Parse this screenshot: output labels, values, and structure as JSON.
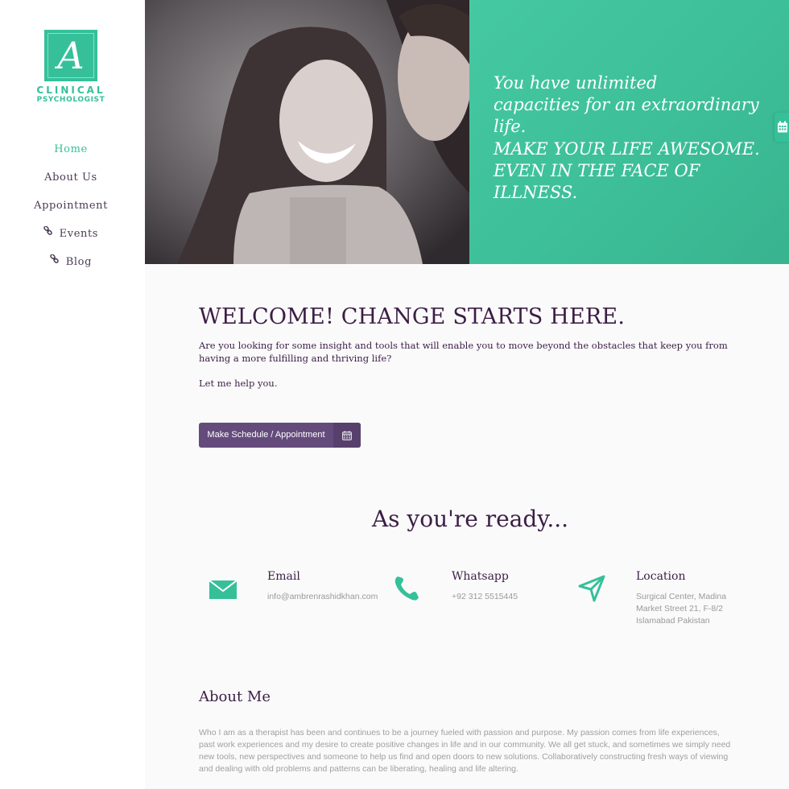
{
  "logo": {
    "letter": "A",
    "line1": "CLINICAL",
    "line2": "PSYCHOLOGIST"
  },
  "nav": {
    "items": [
      {
        "label": "Home",
        "active": true,
        "icon": null
      },
      {
        "label": "About Us",
        "active": false,
        "icon": null
      },
      {
        "label": "Appointment",
        "active": false,
        "icon": null
      },
      {
        "label": "Events",
        "active": false,
        "icon": "link-icon"
      },
      {
        "label": "Blog",
        "active": false,
        "icon": "link-icon"
      }
    ]
  },
  "hero": {
    "quote_line1": "You have unlimited",
    "quote_line2": "capacities for an extraordinary life.",
    "slogan_line1": "MAKE YOUR LIFE AWESOME.",
    "slogan_line2": "EVEN IN THE FACE OF ILLNESS.",
    "tab_icon": "calendar-icon"
  },
  "welcome": {
    "title": "WELCOME! CHANGE STARTS HERE.",
    "text": "Are you looking for some insight and tools that will enable you to move beyond the obstacles that keep you from having a more fulfilling and thriving life?",
    "help": "Let me help you.",
    "button_label": "Make Schedule / Appointment",
    "button_icon": "calendar-icon"
  },
  "ready": {
    "title": "As you're ready..."
  },
  "contacts": {
    "email": {
      "title": "Email",
      "text": "info@ambrenrashidkhan.com",
      "icon": "envelope-icon"
    },
    "whatsapp": {
      "title": "Whatsapp",
      "text": "+92 312 5515445",
      "icon": "phone-icon"
    },
    "location": {
      "title": "Location",
      "text": "Surgical Center, Madina Market Street 21, F-8/2 Islamabad Pakistan",
      "icon": "location-arrow-icon"
    }
  },
  "about": {
    "title": "About Me",
    "text": "Who I am as a therapist has been and continues to be a journey fueled with passion and purpose. My passion comes from life experiences, past work experiences and my desire to create positive changes in life and in our community. We all get stuck, and sometimes we simply need new tools, new perspectives and someone to help us find and open doors to new solutions. Collaboratively constructing fresh ways of viewing and dealing with old problems and patterns can be liberating, healing and life altering."
  },
  "colors": {
    "accent": "#35c09a",
    "brand_purple": "#3b1e45",
    "button": "#654b7c"
  }
}
